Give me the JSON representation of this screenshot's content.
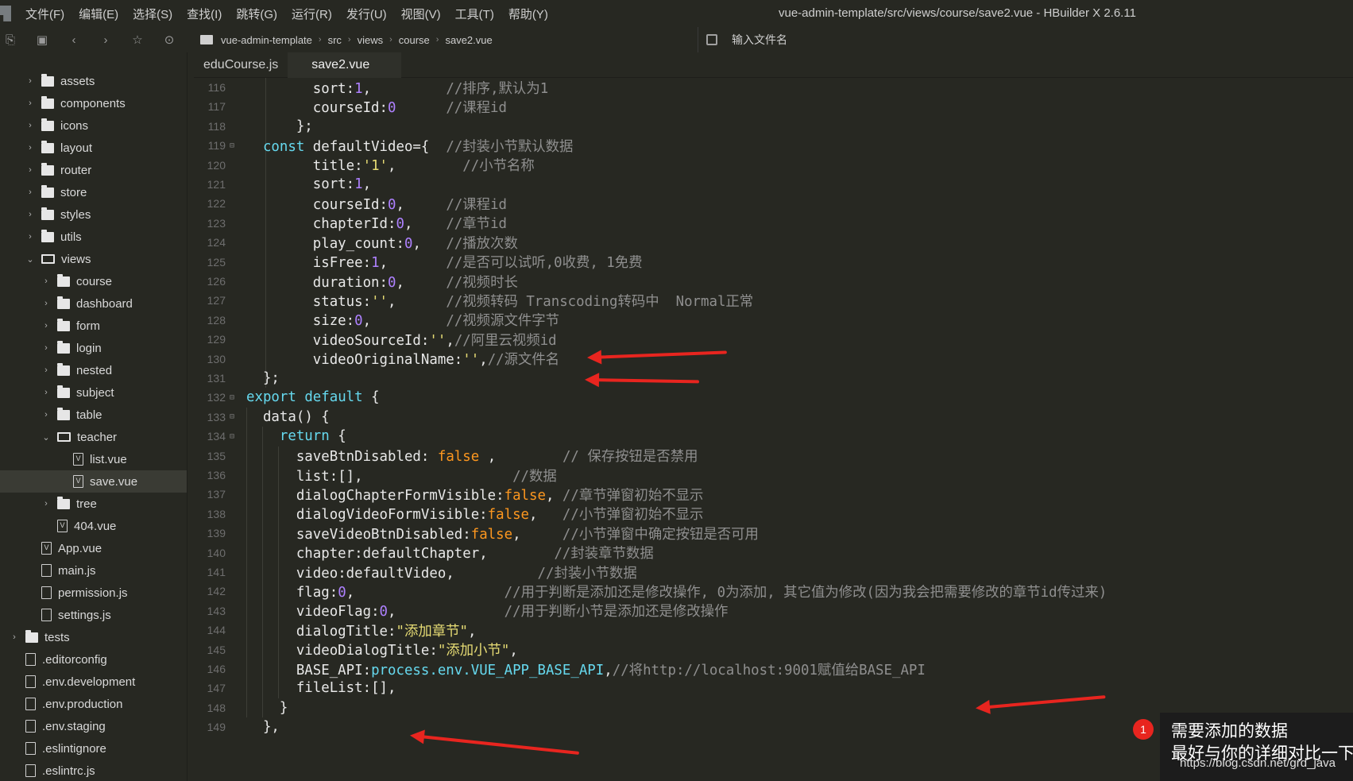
{
  "menubar": {
    "items": [
      "文件(F)",
      "编辑(E)",
      "选择(S)",
      "查找(I)",
      "跳转(G)",
      "运行(R)",
      "发行(U)",
      "视图(V)",
      "工具(T)",
      "帮助(Y)"
    ],
    "window_title": "vue-admin-template/src/views/course/save2.vue - HBuilder X 2.6.11"
  },
  "toolbar": {
    "breadcrumb": [
      "vue-admin-template",
      "src",
      "views",
      "course",
      "save2.vue"
    ],
    "search_placeholder": "输入文件名"
  },
  "sidebar": {
    "items": [
      {
        "label": "assets",
        "type": "folder",
        "depth": 1,
        "expanded": false
      },
      {
        "label": "components",
        "type": "folder",
        "depth": 1,
        "expanded": false
      },
      {
        "label": "icons",
        "type": "folder",
        "depth": 1,
        "expanded": false
      },
      {
        "label": "layout",
        "type": "folder",
        "depth": 1,
        "expanded": false
      },
      {
        "label": "router",
        "type": "folder",
        "depth": 1,
        "expanded": false
      },
      {
        "label": "store",
        "type": "folder",
        "depth": 1,
        "expanded": false
      },
      {
        "label": "styles",
        "type": "folder",
        "depth": 1,
        "expanded": false
      },
      {
        "label": "utils",
        "type": "folder",
        "depth": 1,
        "expanded": false
      },
      {
        "label": "views",
        "type": "folder-open",
        "depth": 1,
        "expanded": true
      },
      {
        "label": "course",
        "type": "folder",
        "depth": 2,
        "expanded": false
      },
      {
        "label": "dashboard",
        "type": "folder",
        "depth": 2,
        "expanded": false
      },
      {
        "label": "form",
        "type": "folder",
        "depth": 2,
        "expanded": false
      },
      {
        "label": "login",
        "type": "folder",
        "depth": 2,
        "expanded": false
      },
      {
        "label": "nested",
        "type": "folder",
        "depth": 2,
        "expanded": false
      },
      {
        "label": "subject",
        "type": "folder",
        "depth": 2,
        "expanded": false
      },
      {
        "label": "table",
        "type": "folder",
        "depth": 2,
        "expanded": false
      },
      {
        "label": "teacher",
        "type": "folder-open",
        "depth": 2,
        "expanded": true
      },
      {
        "label": "list.vue",
        "type": "vue",
        "depth": 3
      },
      {
        "label": "save.vue",
        "type": "vue",
        "depth": 3,
        "selected": true
      },
      {
        "label": "tree",
        "type": "folder",
        "depth": 2,
        "expanded": false
      },
      {
        "label": "404.vue",
        "type": "vue",
        "depth": 2
      },
      {
        "label": "App.vue",
        "type": "vue",
        "depth": 1
      },
      {
        "label": "main.js",
        "type": "file",
        "depth": 1
      },
      {
        "label": "permission.js",
        "type": "file",
        "depth": 1
      },
      {
        "label": "settings.js",
        "type": "file",
        "depth": 1
      },
      {
        "label": "tests",
        "type": "folder",
        "depth": 0,
        "expanded": false
      },
      {
        "label": ".editorconfig",
        "type": "file",
        "depth": 0
      },
      {
        "label": ".env.development",
        "type": "file",
        "depth": 0
      },
      {
        "label": ".env.production",
        "type": "file",
        "depth": 0
      },
      {
        "label": ".env.staging",
        "type": "file",
        "depth": 0
      },
      {
        "label": ".eslintignore",
        "type": "file",
        "depth": 0
      },
      {
        "label": ".eslintrc.js",
        "type": "file",
        "depth": 0
      }
    ]
  },
  "tabs": [
    {
      "label": "eduCourse.js",
      "active": false
    },
    {
      "label": "save2.vue",
      "active": true
    }
  ],
  "editor": {
    "lines": [
      {
        "no": "116",
        "fold": "",
        "tokens": [
          [
            "",
            "        "
          ],
          [
            "prop",
            "sort"
          ],
          [
            "punc",
            ":"
          ],
          [
            "num",
            "1"
          ],
          [
            "punc",
            ","
          ],
          [
            "",
            "         "
          ],
          [
            "cmt",
            "//排序,默认为1"
          ]
        ]
      },
      {
        "no": "117",
        "fold": "",
        "tokens": [
          [
            "",
            "        "
          ],
          [
            "prop",
            "courseId"
          ],
          [
            "punc",
            ":"
          ],
          [
            "num",
            "0"
          ],
          [
            "",
            "      "
          ],
          [
            "cmt",
            "//课程id"
          ]
        ]
      },
      {
        "no": "118",
        "fold": "",
        "tokens": [
          [
            "",
            "      "
          ],
          [
            "punc",
            "};"
          ]
        ]
      },
      {
        "no": "119",
        "fold": "⊟",
        "tokens": [
          [
            "",
            "  "
          ],
          [
            "kw",
            "const"
          ],
          [
            "",
            " "
          ],
          [
            "prop",
            "defaultVideo={"
          ],
          [
            "",
            "  "
          ],
          [
            "cmt",
            "//封装小节默认数据"
          ]
        ]
      },
      {
        "no": "120",
        "fold": "",
        "tokens": [
          [
            "",
            "        "
          ],
          [
            "prop",
            "title"
          ],
          [
            "punc",
            ":"
          ],
          [
            "str",
            "'1'"
          ],
          [
            "punc",
            ","
          ],
          [
            "",
            "        "
          ],
          [
            "cmt",
            "//小节名称"
          ]
        ]
      },
      {
        "no": "121",
        "fold": "",
        "tokens": [
          [
            "",
            "        "
          ],
          [
            "prop",
            "sort"
          ],
          [
            "punc",
            ":"
          ],
          [
            "num",
            "1"
          ],
          [
            "punc",
            ","
          ]
        ]
      },
      {
        "no": "122",
        "fold": "",
        "tokens": [
          [
            "",
            "        "
          ],
          [
            "prop",
            "courseId"
          ],
          [
            "punc",
            ":"
          ],
          [
            "num",
            "0"
          ],
          [
            "punc",
            ","
          ],
          [
            "",
            "     "
          ],
          [
            "cmt",
            "//课程id"
          ]
        ]
      },
      {
        "no": "123",
        "fold": "",
        "tokens": [
          [
            "",
            "        "
          ],
          [
            "prop",
            "chapterId"
          ],
          [
            "punc",
            ":"
          ],
          [
            "num",
            "0"
          ],
          [
            "punc",
            ","
          ],
          [
            "",
            "    "
          ],
          [
            "cmt",
            "//章节id"
          ]
        ]
      },
      {
        "no": "124",
        "fold": "",
        "tokens": [
          [
            "",
            "        "
          ],
          [
            "prop",
            "play_count"
          ],
          [
            "punc",
            ":"
          ],
          [
            "num",
            "0"
          ],
          [
            "punc",
            ","
          ],
          [
            "",
            "   "
          ],
          [
            "cmt",
            "//播放次数"
          ]
        ]
      },
      {
        "no": "125",
        "fold": "",
        "tokens": [
          [
            "",
            "        "
          ],
          [
            "prop",
            "isFree"
          ],
          [
            "punc",
            ":"
          ],
          [
            "num",
            "1"
          ],
          [
            "punc",
            ","
          ],
          [
            "",
            "       "
          ],
          [
            "cmt",
            "//是否可以试听,0收费, 1免费"
          ]
        ]
      },
      {
        "no": "126",
        "fold": "",
        "tokens": [
          [
            "",
            "        "
          ],
          [
            "prop",
            "duration"
          ],
          [
            "punc",
            ":"
          ],
          [
            "num",
            "0"
          ],
          [
            "punc",
            ","
          ],
          [
            "",
            "     "
          ],
          [
            "cmt",
            "//视频时长"
          ]
        ]
      },
      {
        "no": "127",
        "fold": "",
        "tokens": [
          [
            "",
            "        "
          ],
          [
            "prop",
            "status"
          ],
          [
            "punc",
            ":"
          ],
          [
            "str",
            "''"
          ],
          [
            "punc",
            ","
          ],
          [
            "",
            "      "
          ],
          [
            "cmt",
            "//视频转码 Transcoding转码中  Normal正常"
          ]
        ]
      },
      {
        "no": "128",
        "fold": "",
        "tokens": [
          [
            "",
            "        "
          ],
          [
            "prop",
            "size"
          ],
          [
            "punc",
            ":"
          ],
          [
            "num",
            "0"
          ],
          [
            "punc",
            ","
          ],
          [
            "",
            "         "
          ],
          [
            "cmt",
            "//视频源文件字节"
          ]
        ]
      },
      {
        "no": "129",
        "fold": "",
        "tokens": [
          [
            "",
            "        "
          ],
          [
            "prop",
            "videoSourceId"
          ],
          [
            "punc",
            ":"
          ],
          [
            "str",
            "''"
          ],
          [
            "punc",
            ","
          ],
          [
            "cmt",
            "//阿里云视频id"
          ]
        ]
      },
      {
        "no": "130",
        "fold": "",
        "tokens": [
          [
            "",
            "        "
          ],
          [
            "prop",
            "videoOriginalName"
          ],
          [
            "punc",
            ":"
          ],
          [
            "str",
            "''"
          ],
          [
            "punc",
            ","
          ],
          [
            "cmt",
            "//源文件名"
          ]
        ]
      },
      {
        "no": "131",
        "fold": "",
        "tokens": [
          [
            "",
            "  "
          ],
          [
            "punc",
            "};"
          ]
        ]
      },
      {
        "no": "132",
        "fold": "⊟",
        "tokens": [
          [
            "kw",
            "export"
          ],
          [
            "",
            " "
          ],
          [
            "kw",
            "default"
          ],
          [
            "",
            " "
          ],
          [
            "punc",
            "{"
          ]
        ]
      },
      {
        "no": "133",
        "fold": "⊟",
        "tokens": [
          [
            "",
            "  "
          ],
          [
            "prop",
            "data"
          ],
          [
            "punc",
            "() {"
          ]
        ]
      },
      {
        "no": "134",
        "fold": "⊟",
        "tokens": [
          [
            "",
            "    "
          ],
          [
            "kw",
            "return"
          ],
          [
            "",
            " "
          ],
          [
            "punc",
            "{"
          ]
        ]
      },
      {
        "no": "135",
        "fold": "",
        "tokens": [
          [
            "",
            "      "
          ],
          [
            "prop",
            "saveBtnDisabled"
          ],
          [
            "punc",
            ": "
          ],
          [
            "bool",
            "false"
          ],
          [
            "",
            " "
          ],
          [
            "punc",
            ","
          ],
          [
            "",
            "        "
          ],
          [
            "cmt",
            "// 保存按钮是否禁用"
          ]
        ]
      },
      {
        "no": "136",
        "fold": "",
        "tokens": [
          [
            "",
            "      "
          ],
          [
            "prop",
            "list"
          ],
          [
            "punc",
            ":[],"
          ],
          [
            "",
            "                  "
          ],
          [
            "cmt",
            "//数据"
          ]
        ]
      },
      {
        "no": "137",
        "fold": "",
        "tokens": [
          [
            "",
            "      "
          ],
          [
            "prop",
            "dialogChapterFormVisible"
          ],
          [
            "punc",
            ":"
          ],
          [
            "bool",
            "false"
          ],
          [
            "punc",
            ","
          ],
          [
            "",
            " "
          ],
          [
            "cmt",
            "//章节弹窗初始不显示"
          ]
        ]
      },
      {
        "no": "138",
        "fold": "",
        "tokens": [
          [
            "",
            "      "
          ],
          [
            "prop",
            "dialogVideoFormVisible"
          ],
          [
            "punc",
            ":"
          ],
          [
            "bool",
            "false"
          ],
          [
            "punc",
            ","
          ],
          [
            "",
            "   "
          ],
          [
            "cmt",
            "//小节弹窗初始不显示"
          ]
        ]
      },
      {
        "no": "139",
        "fold": "",
        "tokens": [
          [
            "",
            "      "
          ],
          [
            "prop",
            "saveVideoBtnDisabled"
          ],
          [
            "punc",
            ":"
          ],
          [
            "bool",
            "false"
          ],
          [
            "punc",
            ","
          ],
          [
            "",
            "     "
          ],
          [
            "cmt",
            "//小节弹窗中确定按钮是否可用"
          ]
        ]
      },
      {
        "no": "140",
        "fold": "",
        "tokens": [
          [
            "",
            "      "
          ],
          [
            "prop",
            "chapter"
          ],
          [
            "punc",
            ":"
          ],
          [
            "prop",
            "defaultChapter"
          ],
          [
            "punc",
            ","
          ],
          [
            "",
            "        "
          ],
          [
            "cmt",
            "//封装章节数据"
          ]
        ]
      },
      {
        "no": "141",
        "fold": "",
        "tokens": [
          [
            "",
            "      "
          ],
          [
            "prop",
            "video"
          ],
          [
            "punc",
            ":"
          ],
          [
            "prop",
            "defaultVideo"
          ],
          [
            "punc",
            ","
          ],
          [
            "",
            "          "
          ],
          [
            "cmt",
            "//封装小节数据"
          ]
        ]
      },
      {
        "no": "142",
        "fold": "",
        "tokens": [
          [
            "",
            "      "
          ],
          [
            "prop",
            "flag"
          ],
          [
            "punc",
            ":"
          ],
          [
            "num",
            "0"
          ],
          [
            "punc",
            ","
          ],
          [
            "",
            "                  "
          ],
          [
            "cmt",
            "//用于判断是添加还是修改操作, 0为添加, 其它值为修改(因为我会把需要修改的章节id传过来)"
          ]
        ]
      },
      {
        "no": "143",
        "fold": "",
        "tokens": [
          [
            "",
            "      "
          ],
          [
            "prop",
            "videoFlag"
          ],
          [
            "punc",
            ":"
          ],
          [
            "num",
            "0"
          ],
          [
            "punc",
            ","
          ],
          [
            "",
            "             "
          ],
          [
            "cmt",
            "//用于判断小节是添加还是修改操作"
          ]
        ]
      },
      {
        "no": "144",
        "fold": "",
        "tokens": [
          [
            "",
            "      "
          ],
          [
            "prop",
            "dialogTitle"
          ],
          [
            "punc",
            ":"
          ],
          [
            "str",
            "\"添加章节\""
          ],
          [
            "punc",
            ","
          ]
        ]
      },
      {
        "no": "145",
        "fold": "",
        "tokens": [
          [
            "",
            "      "
          ],
          [
            "prop",
            "videoDialogTitle"
          ],
          [
            "punc",
            ":"
          ],
          [
            "str",
            "\"添加小节\""
          ],
          [
            "punc",
            ","
          ]
        ]
      },
      {
        "no": "146",
        "fold": "",
        "tokens": [
          [
            "",
            "      "
          ],
          [
            "prop",
            "BASE_API"
          ],
          [
            "punc",
            ":"
          ],
          [
            "api",
            "process.env.VUE_APP_BASE_API"
          ],
          [
            "punc",
            ","
          ],
          [
            "cmt",
            "//将http://localhost:9001赋值给BASE_API"
          ]
        ]
      },
      {
        "no": "147",
        "fold": "",
        "tokens": [
          [
            "",
            "      "
          ],
          [
            "prop",
            "fileList"
          ],
          [
            "punc",
            ":[],"
          ]
        ]
      },
      {
        "no": "148",
        "fold": "",
        "tokens": [
          [
            "",
            "    "
          ],
          [
            "punc",
            "}"
          ]
        ]
      },
      {
        "no": "149",
        "fold": "",
        "tokens": [
          [
            "",
            "  "
          ],
          [
            "punc",
            "},"
          ]
        ]
      }
    ]
  },
  "note": {
    "badge": "1",
    "lines": [
      "需要添加的数据",
      "最好与你的详细对比一下"
    ],
    "watermark": "https://blog.csdn.net/grd_java"
  }
}
